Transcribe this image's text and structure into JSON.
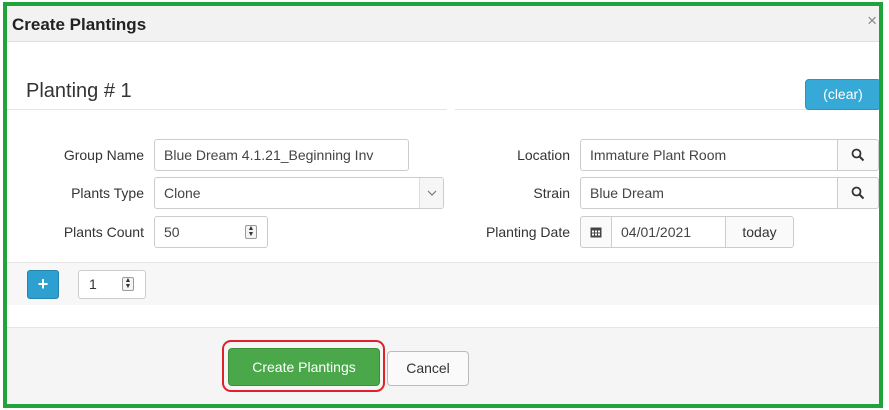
{
  "dialog": {
    "title": "Create Plantings",
    "close_glyph": "×"
  },
  "panel": {
    "title": "Planting # 1",
    "clear_label": "(clear)"
  },
  "form": {
    "group_name": {
      "label": "Group Name",
      "value": "Blue Dream 4.1.21_Beginning Inv"
    },
    "plants_type": {
      "label": "Plants Type",
      "value": "Clone"
    },
    "plants_count": {
      "label": "Plants Count",
      "value": "50"
    },
    "location": {
      "label": "Location",
      "value": "Immature Plant Room"
    },
    "strain": {
      "label": "Strain",
      "value": "Blue Dream"
    },
    "planting_date": {
      "label": "Planting Date",
      "value": "04/01/2021",
      "today_label": "today"
    }
  },
  "add_row": {
    "plus_glyph": "+",
    "count_value": "1"
  },
  "footer": {
    "create_label": "Create Plantings",
    "cancel_label": "Cancel"
  },
  "icons": {
    "search": "search-icon",
    "calendar": "calendar-icon",
    "chevron": "chevron-down-icon",
    "spinner": "spinner-icon"
  },
  "colors": {
    "frame_green": "#1fa33a",
    "info_blue": "#36a9d6",
    "success_green": "#4aa84a",
    "highlight_red": "#e0202a"
  }
}
